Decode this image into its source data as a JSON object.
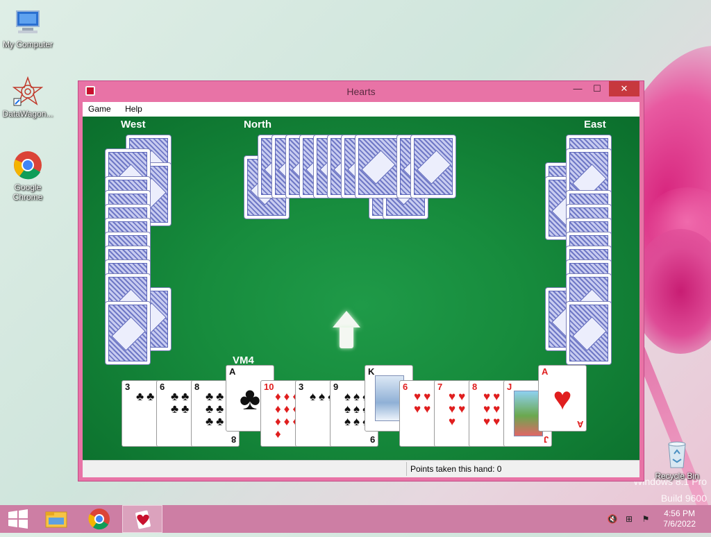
{
  "desktop": {
    "icons": [
      {
        "label": "My Computer",
        "icon": "computer-icon"
      },
      {
        "label": "DataWagon...",
        "icon": "datawagon-icon"
      },
      {
        "label": "Google Chrome",
        "icon": "chrome-icon"
      },
      {
        "label": "Recycle Bin",
        "icon": "recycle-bin-icon"
      }
    ],
    "watermark_line1": "Windows 8.1 Pro",
    "watermark_line2": "Build 9600"
  },
  "window": {
    "title": "Hearts",
    "menu": [
      "Game",
      "Help"
    ],
    "controls": {
      "minimize": "—",
      "maximize": "☐",
      "close": "✕"
    }
  },
  "game": {
    "players": {
      "west": "West",
      "north": "North",
      "east": "East",
      "south": "VM4"
    },
    "pass_direction_icon": "up-arrow-icon",
    "hand": [
      {
        "rank": "3",
        "suit": "♣",
        "color": "#111111"
      },
      {
        "rank": "6",
        "suit": "♣",
        "color": "#111111"
      },
      {
        "rank": "8",
        "suit": "♣",
        "color": "#111111"
      },
      {
        "rank": "A",
        "suit": "♣",
        "color": "#111111"
      },
      {
        "rank": "10",
        "suit": "♦",
        "color": "#e01e1e"
      },
      {
        "rank": "3",
        "suit": "♠",
        "color": "#111111"
      },
      {
        "rank": "9",
        "suit": "♠",
        "color": "#111111"
      },
      {
        "rank": "K",
        "suit": "♠",
        "color": "#111111"
      },
      {
        "rank": "6",
        "suit": "♥",
        "color": "#e01e1e"
      },
      {
        "rank": "7",
        "suit": "♥",
        "color": "#e01e1e"
      },
      {
        "rank": "8",
        "suit": "♥",
        "color": "#e01e1e"
      },
      {
        "rank": "J",
        "suit": "♥",
        "color": "#e01e1e"
      },
      {
        "rank": "A",
        "suit": "♥",
        "color": "#e01e1e"
      }
    ]
  },
  "status": {
    "points": "Points taken this hand: 0"
  },
  "taskbar": {
    "buttons": [
      "start-icon",
      "file-explorer-icon",
      "chrome-icon",
      "hearts-icon"
    ],
    "time": "4:56 PM",
    "date": "7/6/2022"
  }
}
